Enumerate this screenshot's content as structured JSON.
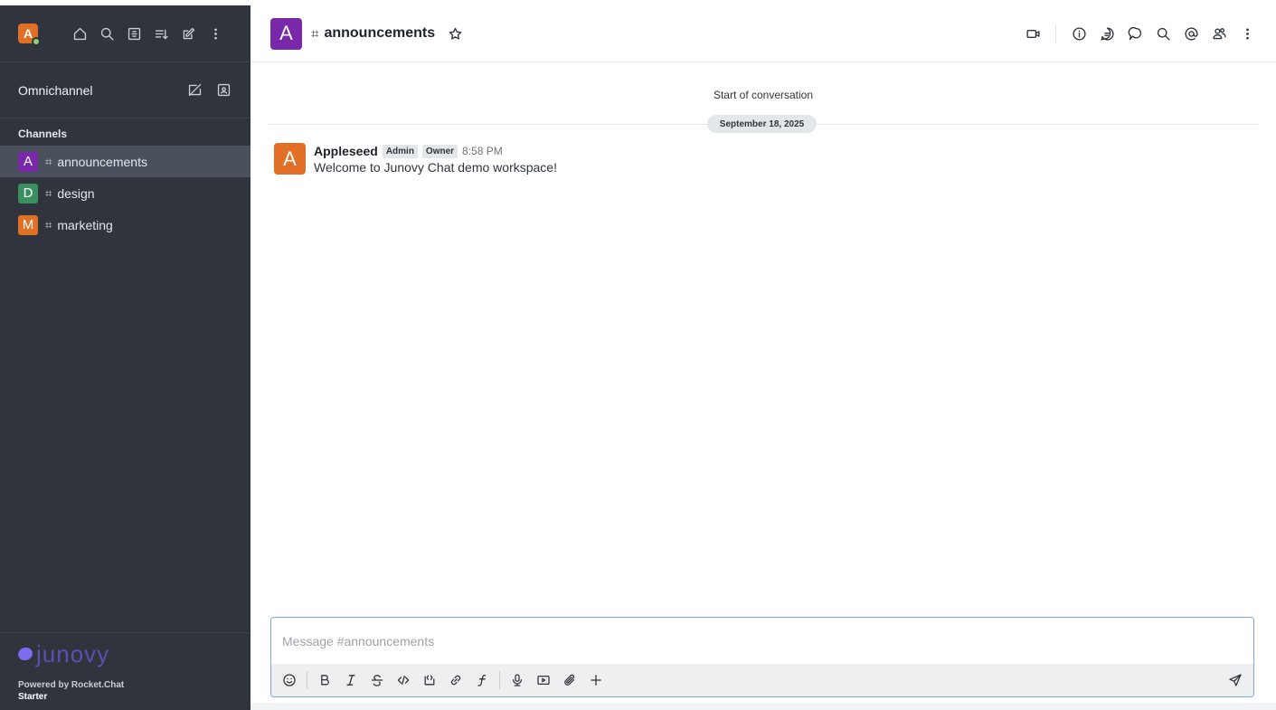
{
  "colors": {
    "sidebar_bg": "#2f343d",
    "active_room_bg": "#4a515c",
    "avatar_announcements": "#7828a8",
    "avatar_design": "#3a9060",
    "avatar_marketing": "#e16f26",
    "user_avatar": "#e16f26",
    "composer_border": "#7ba7e6"
  },
  "sidebar": {
    "user_avatar_letter": "A",
    "top_icons": [
      "home-icon",
      "search-icon",
      "directory-icon",
      "sort-icon",
      "create-new-icon",
      "kebab-menu-icon"
    ],
    "omnichannel": {
      "title": "Omnichannel",
      "icons": [
        "omnichannel-status-icon",
        "contact-center-icon"
      ]
    },
    "section_title": "Channels",
    "rooms": [
      {
        "letter": "A",
        "name": "announcements",
        "active": true
      },
      {
        "letter": "D",
        "name": "design",
        "active": false
      },
      {
        "letter": "M",
        "name": "marketing",
        "active": false
      }
    ],
    "footer": {
      "logo_text": "junovy",
      "powered_by": "Powered by Rocket.Chat",
      "plan": "Starter"
    }
  },
  "header": {
    "avatar_letter": "A",
    "room_name": "announcements",
    "actions": [
      "video-call-icon",
      "room-info-icon",
      "threads-icon",
      "discussions-icon",
      "search-messages-icon",
      "mentions-icon",
      "members-icon",
      "kebab-menu-icon"
    ]
  },
  "conversation": {
    "start_label": "Start of conversation",
    "date_label": "September 18, 2025",
    "messages": [
      {
        "avatar_letter": "A",
        "user": "Appleseed",
        "tags": [
          "Admin",
          "Owner"
        ],
        "time": "8:58 PM",
        "text": "Welcome to Junovy Chat demo workspace!"
      }
    ]
  },
  "composer": {
    "placeholder": "Message #announcements",
    "value": "",
    "tools": [
      "emoji-icon",
      "bold-icon",
      "italic-icon",
      "strikethrough-icon",
      "code-icon",
      "code-block-icon",
      "link-icon",
      "formula-icon",
      "audio-message-icon",
      "video-message-icon",
      "attach-icon",
      "plus-icon"
    ],
    "send_icon": "send-icon"
  }
}
